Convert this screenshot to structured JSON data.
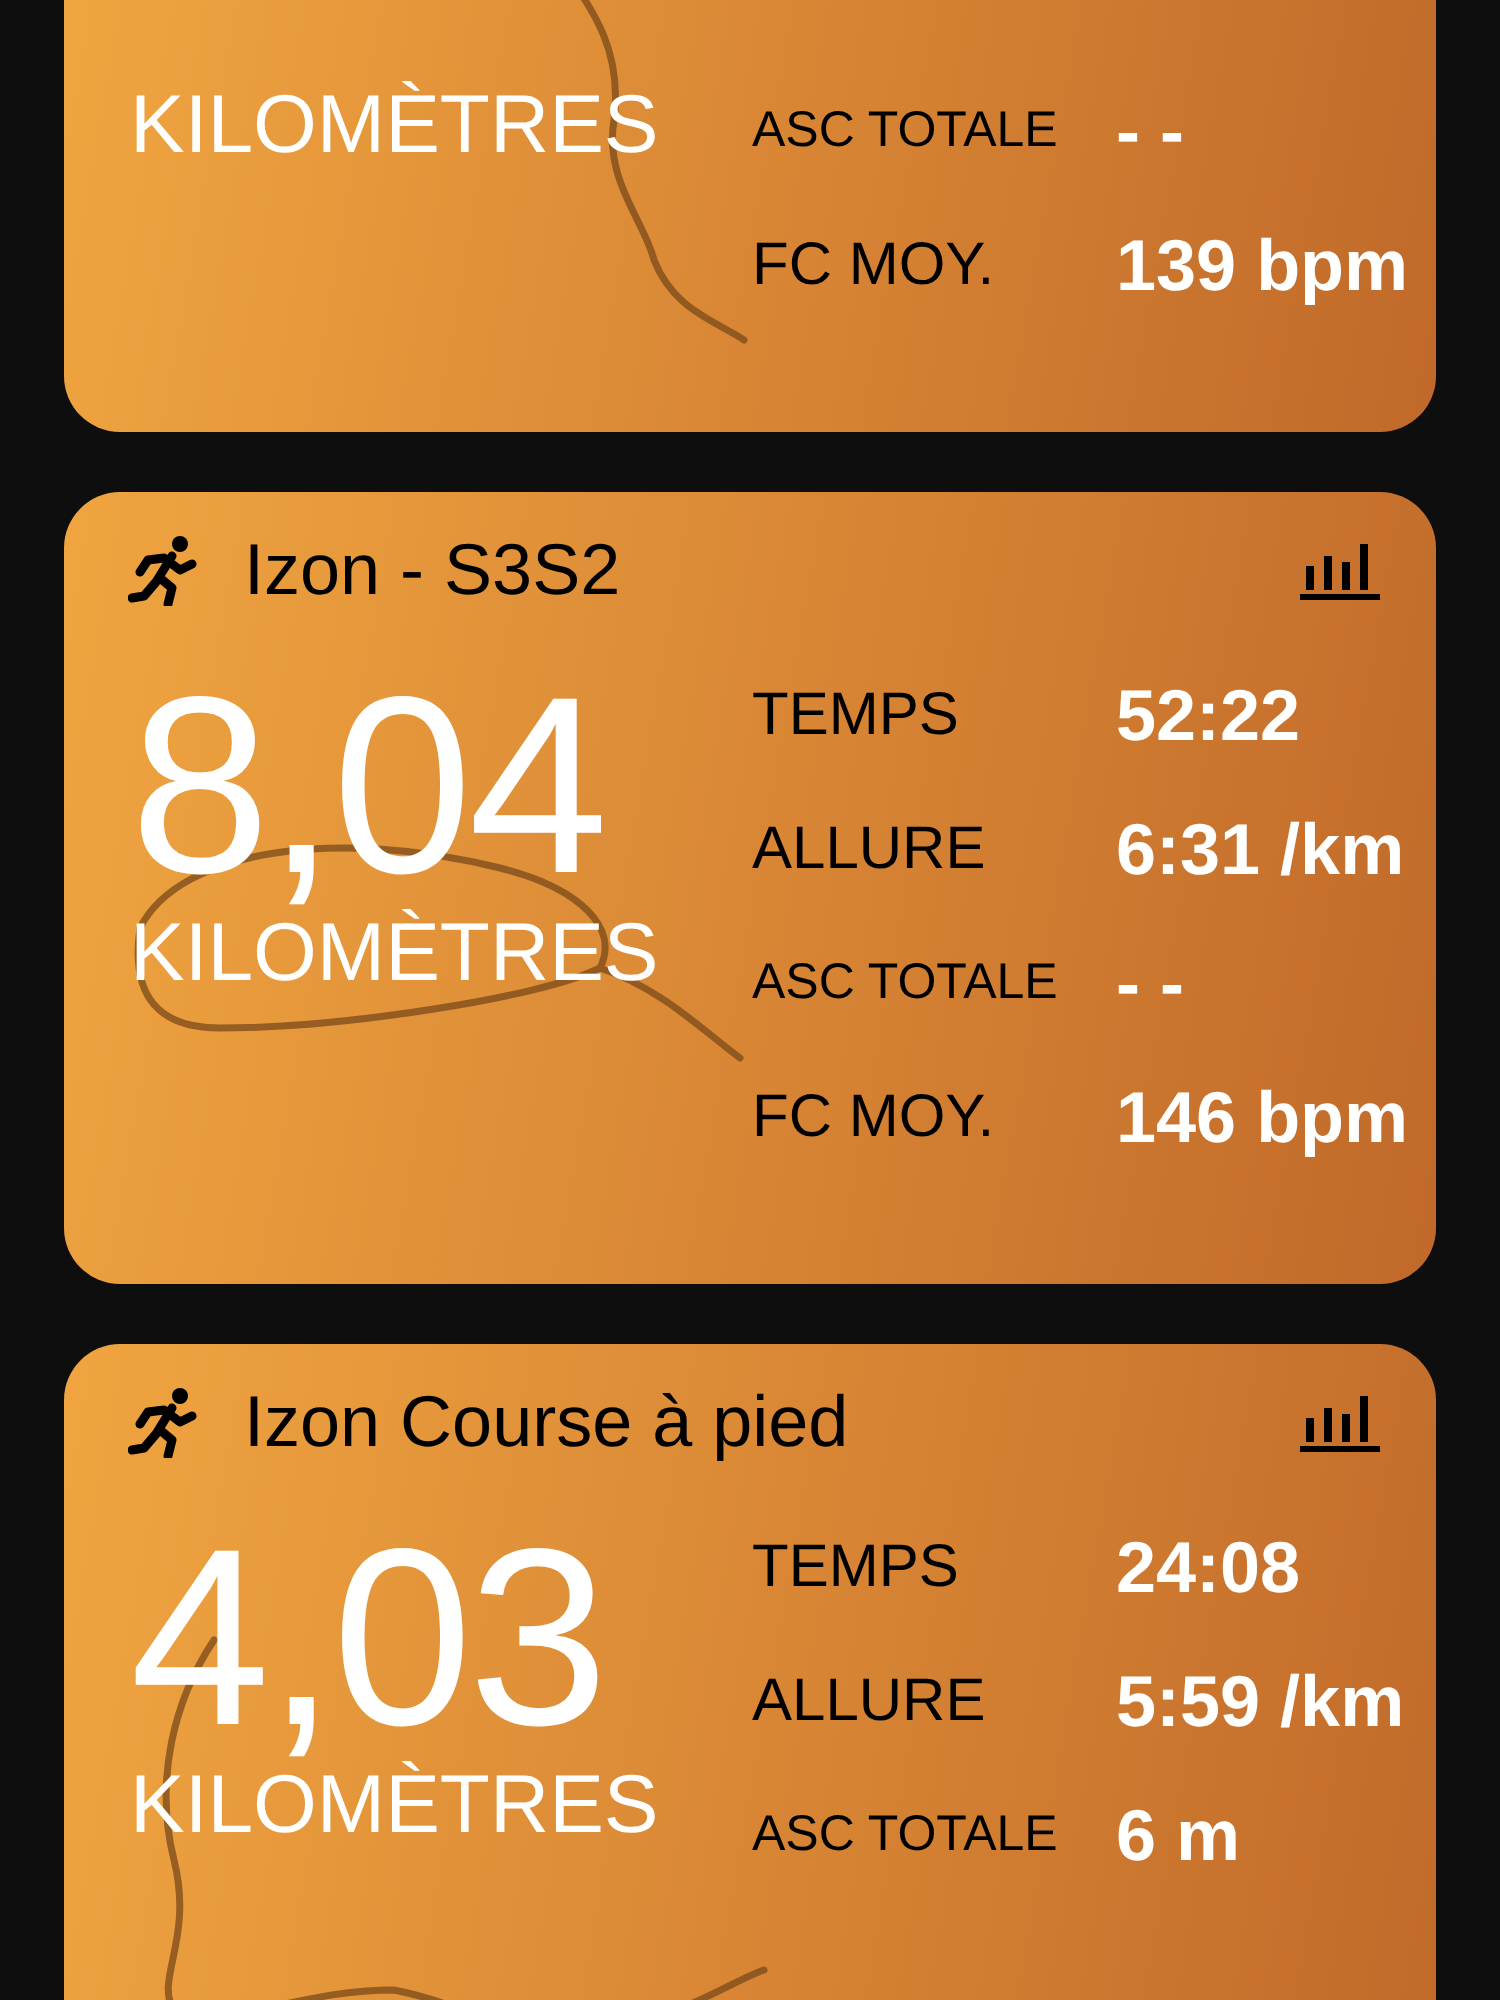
{
  "activities": [
    {
      "unit": "KILOMÈTRES",
      "stats": [
        {
          "kind": "ascent",
          "label": "ASC TOTALE",
          "value": "- -"
        },
        {
          "kind": "heart_rate",
          "label": "FC MOY.",
          "value": "139 bpm"
        }
      ]
    },
    {
      "title": "Izon - S3S2",
      "distance": "8,04",
      "unit": "KILOMÈTRES",
      "stats": [
        {
          "kind": "time",
          "label": "TEMPS",
          "value": "52:22"
        },
        {
          "kind": "pace",
          "label": "ALLURE",
          "value": "6:31 /km"
        },
        {
          "kind": "ascent",
          "label": "ASC TOTALE",
          "value": "- -"
        },
        {
          "kind": "heart_rate",
          "label": "FC MOY.",
          "value": "146 bpm"
        }
      ]
    },
    {
      "title": "Izon Course à pied",
      "distance": "4,03",
      "unit": "KILOMÈTRES",
      "stats": [
        {
          "kind": "time",
          "label": "TEMPS",
          "value": "24:08"
        },
        {
          "kind": "pace",
          "label": "ALLURE",
          "value": "5:59 /km"
        },
        {
          "kind": "ascent",
          "label": "ASC TOTALE",
          "value": "6 m"
        }
      ]
    }
  ]
}
